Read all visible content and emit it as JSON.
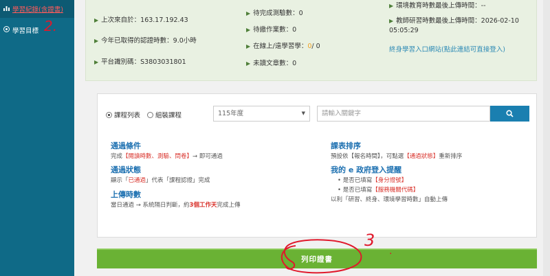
{
  "sidebar": {
    "items": [
      {
        "label": "學習紀錄(含證書)",
        "icon": "chart-icon"
      },
      {
        "label": "學習目標",
        "icon": "target-icon"
      }
    ]
  },
  "annotations": {
    "mark2": "2.",
    "mark3": "3",
    "dot": "."
  },
  "stats": {
    "last_ip": "上次來自於：163.17.192.43",
    "cert_hours": "今年已取得的認證時數：9.0小時",
    "platform_id": "平台識別碼：S3803031801",
    "pending_tests": "待完成測驗數：0",
    "pending_homework": "待繳作業數：0",
    "online_status_prefix": "在線上/遠學習學：",
    "online_count_a": "0",
    "online_count_b": "/ 0",
    "unread_articles": "未讀文章數：0",
    "env_edu_upload": "環境教育時數最後上傳時間：--",
    "teacher_upload": "教師研習時數最後上傳時間：2026-02-10 05:05:29",
    "portal_link": "終身學習入口網站(點此連結可直接登入)"
  },
  "filter": {
    "radio_course_list": "課程列表",
    "radio_group_course": "組裝課程",
    "year_selected": "115年度",
    "search_placeholder": "請輸入關鍵字"
  },
  "info": {
    "pass_title": "通過條件",
    "pass_pre": "完成",
    "pass_red": "【閱讀時數、測驗、問卷】",
    "pass_post": "→ 即可通過",
    "status_title": "通過狀態",
    "status_pre": "顯示「",
    "status_red": "已通過",
    "status_post": "」代表「課程認證」完成",
    "upload_title": "上傳時數",
    "upload_pre": "當日通過 → 系統隔日判斷，約",
    "upload_red": "3個工作天",
    "upload_post": "完成上傳",
    "sort_title": "課表排序",
    "sort_pre": "預設依【報名時間】，可點選",
    "sort_red": "【通過狀態】",
    "sort_post": "重新排序",
    "egov_title": "我的 e 政府登入提醒",
    "egov_b1_pre": "是否已填寫",
    "egov_b1_red": "【身分證號】",
    "egov_b2_pre": "是否已填寫",
    "egov_b2_red": "【服務機關代碼】",
    "egov_note": "以利「研習、終身、環境學習時數」自動上傳"
  },
  "print_button": "列印證書"
}
